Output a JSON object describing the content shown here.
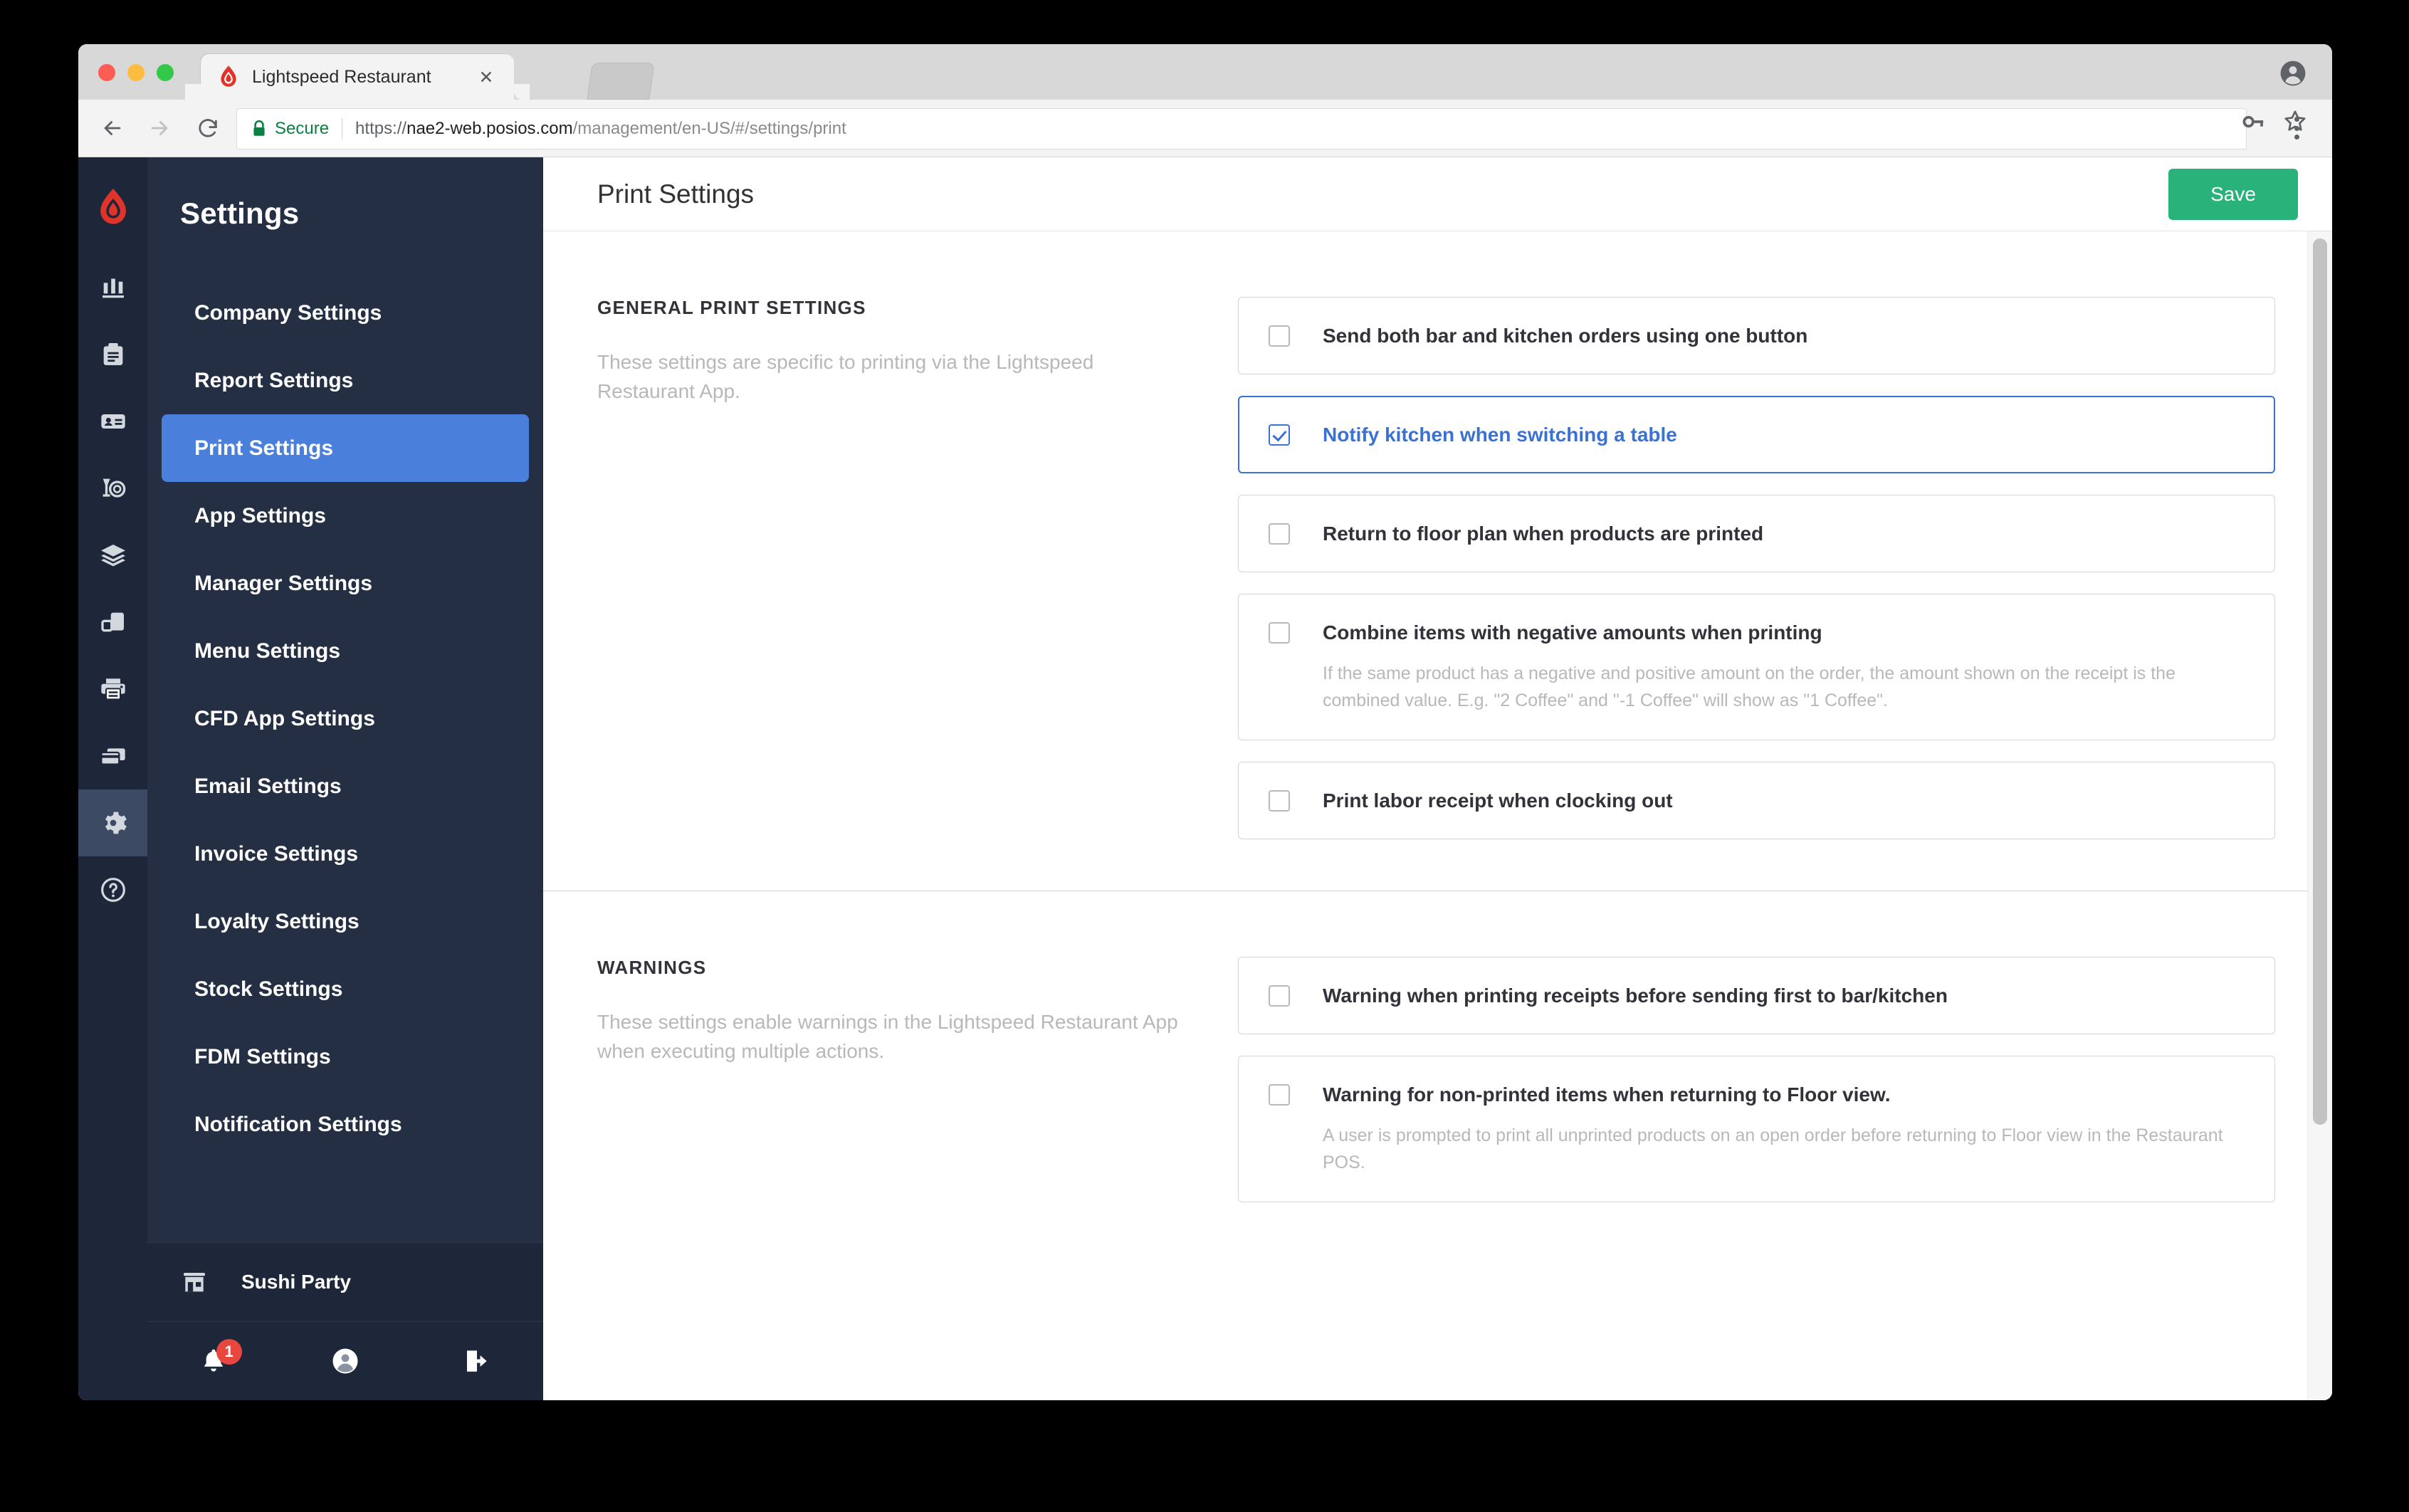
{
  "browser": {
    "tab": {
      "title": "Lightspeed Restaurant",
      "close_label": "✕",
      "favicon": "lightspeed-flame-icon"
    },
    "second_tab_label": "",
    "omnibox": {
      "security_label": "Secure",
      "url_scheme": "https://",
      "url_host": "nae2-web.posios.com",
      "url_path": "/management/en-US/#/settings/print",
      "url_full": "https://nae2-web.posios.com/management/en-US/#/settings/print"
    },
    "nav": {
      "back": "back-icon",
      "forward": "forward-icon",
      "reload": "reload-icon"
    },
    "actions": {
      "key": "key-icon",
      "star": "star-icon",
      "menu": "three-dot-menu-icon",
      "profile": "profile-avatar-icon"
    }
  },
  "sidebar": {
    "title": "Settings",
    "items": [
      {
        "label": "Company Settings",
        "active": false
      },
      {
        "label": "Report Settings",
        "active": false
      },
      {
        "label": "Print Settings",
        "active": true
      },
      {
        "label": "App Settings",
        "active": false
      },
      {
        "label": "Manager Settings",
        "active": false
      },
      {
        "label": "Menu Settings",
        "active": false
      },
      {
        "label": "CFD App Settings",
        "active": false
      },
      {
        "label": "Email Settings",
        "active": false
      },
      {
        "label": "Invoice Settings",
        "active": false
      },
      {
        "label": "Loyalty Settings",
        "active": false
      },
      {
        "label": "Stock Settings",
        "active": false
      },
      {
        "label": "FDM Settings",
        "active": false
      },
      {
        "label": "Notification Settings",
        "active": false
      }
    ],
    "store_name": "Sushi Party",
    "store_icon": "storefront-icon",
    "footer": {
      "notifications_icon": "bell-icon",
      "notifications_count": "1",
      "account_icon": "user-circle-icon",
      "logout_icon": "logout-icon"
    },
    "rail_icons": [
      {
        "name": "bar-chart-icon",
        "active": false
      },
      {
        "name": "clipboard-icon",
        "active": false
      },
      {
        "name": "id-card-icon",
        "active": false
      },
      {
        "name": "food-and-drink-icon",
        "active": false
      },
      {
        "name": "layers-icon",
        "active": false
      },
      {
        "name": "devices-icon",
        "active": false
      },
      {
        "name": "printer-icon",
        "active": false
      },
      {
        "name": "card-payment-icon",
        "active": false
      },
      {
        "name": "gear-icon",
        "active": true
      },
      {
        "name": "help-circle-icon",
        "active": false
      }
    ],
    "logo_icon": "lightspeed-flame-logo"
  },
  "header": {
    "title": "Print Settings",
    "save_label": "Save",
    "save_color": "#2ab27b"
  },
  "sections": [
    {
      "heading": "GENERAL PRINT SETTINGS",
      "description": "These settings are specific to printing via the Lightspeed Restaurant App.",
      "options": [
        {
          "label": "Send both bar and kitchen orders using one button",
          "sub": "",
          "checked": false,
          "selected": false
        },
        {
          "label": "Notify kitchen when switching a table",
          "sub": "",
          "checked": true,
          "selected": true
        },
        {
          "label": "Return to floor plan when products are printed",
          "sub": "",
          "checked": false,
          "selected": false
        },
        {
          "label": "Combine items with negative amounts when printing",
          "sub": "If the same product has a negative and positive amount on the order, the amount shown on the receipt is the combined value. E.g. \"2 Coffee\" and \"-1 Coffee\" will show as \"1 Coffee\".",
          "checked": false,
          "selected": false
        },
        {
          "label": "Print labor receipt when clocking out",
          "sub": "",
          "checked": false,
          "selected": false
        }
      ]
    },
    {
      "heading": "WARNINGS",
      "description": "These settings enable warnings in the Lightspeed Restaurant App when executing multiple actions.",
      "options": [
        {
          "label": "Warning when printing receipts before sending first to bar/kitchen",
          "sub": "",
          "checked": false,
          "selected": false
        },
        {
          "label": "Warning for non-printed items when returning to Floor view.",
          "sub": "A user is prompted to print all unprinted products on an open order before returning to Floor view in the Restaurant POS.",
          "checked": false,
          "selected": false
        }
      ]
    }
  ],
  "colors": {
    "accent_blue": "#4a7fdb",
    "save_green": "#2ab27b",
    "sidebar_bg": "#242f44",
    "rail_bg": "#1e2739",
    "badge_red": "#e8473f",
    "brand_red": "#e0342b"
  }
}
